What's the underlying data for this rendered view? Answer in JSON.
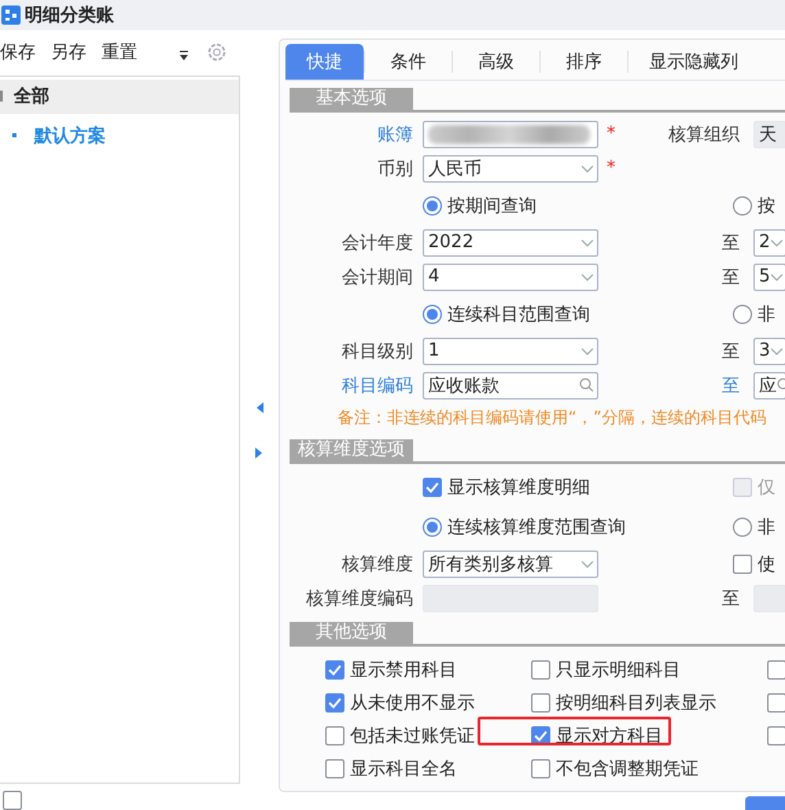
{
  "window": {
    "title": "明细分类账"
  },
  "toolbar": {
    "buttons": [
      "保存",
      "另存",
      "重置"
    ]
  },
  "scheme_tree": [
    {
      "label": "全部",
      "selected": true,
      "children": [
        {
          "label": "默认方案",
          "selected": false
        }
      ]
    }
  ],
  "tabs": [
    {
      "label": "快捷",
      "selected": true
    },
    {
      "label": "条件",
      "selected": false
    },
    {
      "label": "高级",
      "selected": false
    },
    {
      "label": "排序",
      "selected": false
    },
    {
      "label": "显示隐藏列",
      "selected": false
    }
  ],
  "sections": [
    {
      "title": "基本选项",
      "kind": "form",
      "rows": [
        {
          "kind": "field",
          "label": "账簿",
          "label_link": true,
          "control": {
            "kind": "blurred",
            "required_mark": "*"
          },
          "right": {
            "label": "核算组织",
            "label_link": false,
            "control": {
              "kind": "readonly",
              "value": "天"
            }
          }
        },
        {
          "kind": "field",
          "label": "币别",
          "label_link": false,
          "control": {
            "kind": "select",
            "value": "人民币",
            "required_mark": "*"
          }
        },
        {
          "kind": "radio",
          "left": {
            "label": "按期间查询",
            "selected": true
          },
          "right": {
            "label": "按",
            "selected": false
          }
        },
        {
          "kind": "field",
          "label": "会计年度",
          "label_link": false,
          "control": {
            "kind": "select",
            "value": "2022"
          },
          "right": {
            "label": "至",
            "label_link": false,
            "control": {
              "kind": "select",
              "value": "2"
            }
          }
        },
        {
          "kind": "field",
          "label": "会计期间",
          "label_link": false,
          "control": {
            "kind": "select",
            "value": "4"
          },
          "right": {
            "label": "至",
            "label_link": false,
            "control": {
              "kind": "select",
              "value": "5"
            }
          }
        },
        {
          "kind": "radio",
          "left": {
            "label": "连续科目范围查询",
            "selected": true
          },
          "right": {
            "label": "非",
            "selected": false
          }
        },
        {
          "kind": "field",
          "label": "科目级别",
          "label_link": false,
          "control": {
            "kind": "select",
            "value": "1"
          },
          "right": {
            "label": "至",
            "label_link": false,
            "control": {
              "kind": "select",
              "value": "3"
            }
          }
        },
        {
          "kind": "field",
          "label": "科目编码",
          "label_link": true,
          "control": {
            "kind": "search",
            "value": "应收账款"
          },
          "right": {
            "label": "至",
            "label_link": true,
            "control": {
              "kind": "search",
              "value": "应"
            }
          }
        },
        {
          "kind": "note",
          "text": "备注：非连续的科目编码请使用“，”分隔，连续的科目代码"
        }
      ]
    },
    {
      "title": "核算维度选项",
      "kind": "form",
      "rows": [
        {
          "kind": "check",
          "left": {
            "label": "显示核算维度明细",
            "checked": true
          },
          "right": {
            "label": "仅",
            "checked": false,
            "disabled": true
          }
        },
        {
          "kind": "radio",
          "left": {
            "label": "连续核算维度范围查询",
            "selected": true
          },
          "right": {
            "label": "非",
            "selected": false
          }
        },
        {
          "kind": "field",
          "label": "核算维度",
          "label_link": false,
          "control": {
            "kind": "select",
            "value": "所有类别多核算"
          },
          "right_check": {
            "label": "使",
            "checked": false
          }
        },
        {
          "kind": "field",
          "label": "核算维度编码",
          "label_link": false,
          "control": {
            "kind": "disabled"
          },
          "right": {
            "label": "至",
            "label_link": false,
            "control": {
              "kind": "disabled"
            }
          }
        }
      ]
    },
    {
      "title": "其他选项",
      "kind": "grid",
      "rows": [
        [
          {
            "label": "显示禁用科目",
            "checked": true
          },
          {
            "label": "只显示明细科目",
            "checked": false
          },
          {
            "checked": false
          }
        ],
        [
          {
            "label": "从未使用不显示",
            "checked": true
          },
          {
            "label": "按明细科目列表显示",
            "checked": false
          },
          {
            "checked": false
          }
        ],
        [
          {
            "label": "包括未过账凭证",
            "checked": false
          },
          {
            "label": "显示对方科目",
            "checked": true,
            "highlighted": true
          },
          {
            "checked": false
          }
        ],
        [
          {
            "label": "显示科目全名",
            "checked": false
          },
          {
            "label": "不包含调整期凭证",
            "checked": false
          }
        ]
      ]
    }
  ],
  "auto_enter": {
    "checked": false
  }
}
